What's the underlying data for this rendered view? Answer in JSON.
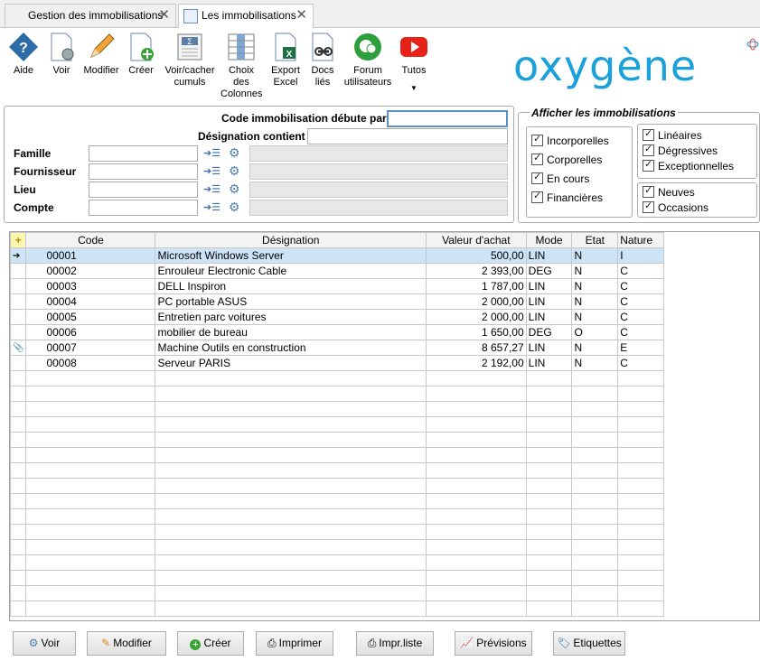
{
  "tabs": [
    {
      "label": "Gestion des immobilisations",
      "close": "✕"
    },
    {
      "label": "Les immobilisations",
      "close": "✕"
    }
  ],
  "toolbar": {
    "aide": "Aide",
    "voir": "Voir",
    "modifier": "Modifier",
    "creer": "Créer",
    "voir_cacher_1": "Voir/cacher",
    "voir_cacher_2": "cumuls",
    "choix_1": "Choix",
    "choix_2": "des",
    "choix_3": "Colonnes",
    "export_1": "Export",
    "export_2": "Excel",
    "docs_1": "Docs",
    "docs_2": "liés",
    "forum_1": "Forum",
    "forum_2": "utilisateurs",
    "tutos": "Tutos"
  },
  "logo": "oxygène",
  "filters": {
    "code_label": "Code immobilisation débute par",
    "designation_label": "Désignation contient",
    "famille": "Famille",
    "fournisseur": "Fournisseur",
    "lieu": "Lieu",
    "compte": "Compte"
  },
  "afficher": {
    "title": "Afficher les immobilisations",
    "types": [
      "Incorporelles",
      "Corporelles",
      "En cours",
      "Financières"
    ],
    "modes": [
      "Linéaires",
      "Dégressives",
      "Exceptionnelles"
    ],
    "etats": [
      "Neuves",
      "Occasions"
    ]
  },
  "grid": {
    "headers": [
      "Code",
      "Désignation",
      "Valeur d'achat",
      "Mode",
      "Etat",
      "Nature"
    ],
    "rows": [
      [
        "00001",
        "Microsoft Windows Server",
        "500,00",
        "LIN",
        "N",
        "I"
      ],
      [
        "00002",
        "Enrouleur Electronic Cable",
        "2 393,00",
        "DEG",
        "N",
        "C"
      ],
      [
        "00003",
        "DELL Inspiron",
        "1 787,00",
        "LIN",
        "N",
        "C"
      ],
      [
        "00004",
        "PC portable ASUS",
        "2 000,00",
        "LIN",
        "N",
        "C"
      ],
      [
        "00005",
        "Entretien parc voitures",
        "2 000,00",
        "LIN",
        "N",
        "C"
      ],
      [
        "00006",
        "mobilier de bureau",
        "1 650,00",
        "DEG",
        "O",
        "C"
      ],
      [
        "00007",
        "Machine Outils en construction",
        "8 657,27",
        "LIN",
        "N",
        "E"
      ],
      [
        "00008",
        "Serveur PARIS",
        "2 192,00",
        "LIN",
        "N",
        "C"
      ]
    ]
  },
  "buttons": {
    "voir": "Voir",
    "modifier": "Modifier",
    "creer": "Créer",
    "imprimer": "Imprimer",
    "impr_liste": "Impr.liste",
    "previsions": "Prévisions",
    "etiquettes": "Etiquettes"
  },
  "colors": {
    "logo": "#1aa0da",
    "selected_row": "#cde4f7"
  }
}
